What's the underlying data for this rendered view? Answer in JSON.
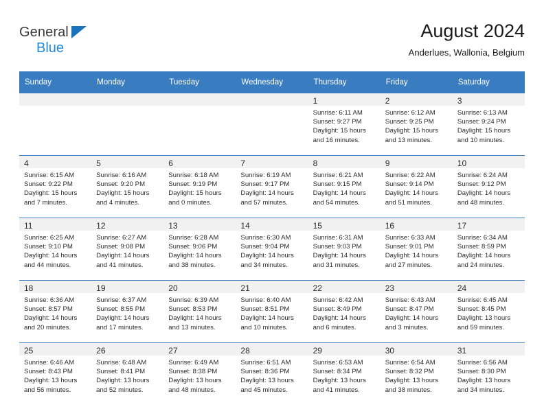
{
  "brand": {
    "name_top": "General",
    "name_bottom": "Blue",
    "triangle_color": "#1a72ba",
    "blue_color": "#2389d6"
  },
  "header": {
    "month_title": "August 2024",
    "location": "Anderlues, Wallonia, Belgium"
  },
  "calendar": {
    "header_bg": "#3a7cc0",
    "daynum_bg": "#f1f1f1",
    "weekdays": [
      "Sunday",
      "Monday",
      "Tuesday",
      "Wednesday",
      "Thursday",
      "Friday",
      "Saturday"
    ],
    "weeks": [
      [
        {
          "day": "",
          "lines": []
        },
        {
          "day": "",
          "lines": []
        },
        {
          "day": "",
          "lines": []
        },
        {
          "day": "",
          "lines": []
        },
        {
          "day": "1",
          "lines": [
            "Sunrise: 6:11 AM",
            "Sunset: 9:27 PM",
            "Daylight: 15 hours",
            "and 16 minutes."
          ]
        },
        {
          "day": "2",
          "lines": [
            "Sunrise: 6:12 AM",
            "Sunset: 9:25 PM",
            "Daylight: 15 hours",
            "and 13 minutes."
          ]
        },
        {
          "day": "3",
          "lines": [
            "Sunrise: 6:13 AM",
            "Sunset: 9:24 PM",
            "Daylight: 15 hours",
            "and 10 minutes."
          ]
        }
      ],
      [
        {
          "day": "4",
          "lines": [
            "Sunrise: 6:15 AM",
            "Sunset: 9:22 PM",
            "Daylight: 15 hours",
            "and 7 minutes."
          ]
        },
        {
          "day": "5",
          "lines": [
            "Sunrise: 6:16 AM",
            "Sunset: 9:20 PM",
            "Daylight: 15 hours",
            "and 4 minutes."
          ]
        },
        {
          "day": "6",
          "lines": [
            "Sunrise: 6:18 AM",
            "Sunset: 9:19 PM",
            "Daylight: 15 hours",
            "and 0 minutes."
          ]
        },
        {
          "day": "7",
          "lines": [
            "Sunrise: 6:19 AM",
            "Sunset: 9:17 PM",
            "Daylight: 14 hours",
            "and 57 minutes."
          ]
        },
        {
          "day": "8",
          "lines": [
            "Sunrise: 6:21 AM",
            "Sunset: 9:15 PM",
            "Daylight: 14 hours",
            "and 54 minutes."
          ]
        },
        {
          "day": "9",
          "lines": [
            "Sunrise: 6:22 AM",
            "Sunset: 9:14 PM",
            "Daylight: 14 hours",
            "and 51 minutes."
          ]
        },
        {
          "day": "10",
          "lines": [
            "Sunrise: 6:24 AM",
            "Sunset: 9:12 PM",
            "Daylight: 14 hours",
            "and 48 minutes."
          ]
        }
      ],
      [
        {
          "day": "11",
          "lines": [
            "Sunrise: 6:25 AM",
            "Sunset: 9:10 PM",
            "Daylight: 14 hours",
            "and 44 minutes."
          ]
        },
        {
          "day": "12",
          "lines": [
            "Sunrise: 6:27 AM",
            "Sunset: 9:08 PM",
            "Daylight: 14 hours",
            "and 41 minutes."
          ]
        },
        {
          "day": "13",
          "lines": [
            "Sunrise: 6:28 AM",
            "Sunset: 9:06 PM",
            "Daylight: 14 hours",
            "and 38 minutes."
          ]
        },
        {
          "day": "14",
          "lines": [
            "Sunrise: 6:30 AM",
            "Sunset: 9:04 PM",
            "Daylight: 14 hours",
            "and 34 minutes."
          ]
        },
        {
          "day": "15",
          "lines": [
            "Sunrise: 6:31 AM",
            "Sunset: 9:03 PM",
            "Daylight: 14 hours",
            "and 31 minutes."
          ]
        },
        {
          "day": "16",
          "lines": [
            "Sunrise: 6:33 AM",
            "Sunset: 9:01 PM",
            "Daylight: 14 hours",
            "and 27 minutes."
          ]
        },
        {
          "day": "17",
          "lines": [
            "Sunrise: 6:34 AM",
            "Sunset: 8:59 PM",
            "Daylight: 14 hours",
            "and 24 minutes."
          ]
        }
      ],
      [
        {
          "day": "18",
          "lines": [
            "Sunrise: 6:36 AM",
            "Sunset: 8:57 PM",
            "Daylight: 14 hours",
            "and 20 minutes."
          ]
        },
        {
          "day": "19",
          "lines": [
            "Sunrise: 6:37 AM",
            "Sunset: 8:55 PM",
            "Daylight: 14 hours",
            "and 17 minutes."
          ]
        },
        {
          "day": "20",
          "lines": [
            "Sunrise: 6:39 AM",
            "Sunset: 8:53 PM",
            "Daylight: 14 hours",
            "and 13 minutes."
          ]
        },
        {
          "day": "21",
          "lines": [
            "Sunrise: 6:40 AM",
            "Sunset: 8:51 PM",
            "Daylight: 14 hours",
            "and 10 minutes."
          ]
        },
        {
          "day": "22",
          "lines": [
            "Sunrise: 6:42 AM",
            "Sunset: 8:49 PM",
            "Daylight: 14 hours",
            "and 6 minutes."
          ]
        },
        {
          "day": "23",
          "lines": [
            "Sunrise: 6:43 AM",
            "Sunset: 8:47 PM",
            "Daylight: 14 hours",
            "and 3 minutes."
          ]
        },
        {
          "day": "24",
          "lines": [
            "Sunrise: 6:45 AM",
            "Sunset: 8:45 PM",
            "Daylight: 13 hours",
            "and 59 minutes."
          ]
        }
      ],
      [
        {
          "day": "25",
          "lines": [
            "Sunrise: 6:46 AM",
            "Sunset: 8:43 PM",
            "Daylight: 13 hours",
            "and 56 minutes."
          ]
        },
        {
          "day": "26",
          "lines": [
            "Sunrise: 6:48 AM",
            "Sunset: 8:41 PM",
            "Daylight: 13 hours",
            "and 52 minutes."
          ]
        },
        {
          "day": "27",
          "lines": [
            "Sunrise: 6:49 AM",
            "Sunset: 8:38 PM",
            "Daylight: 13 hours",
            "and 48 minutes."
          ]
        },
        {
          "day": "28",
          "lines": [
            "Sunrise: 6:51 AM",
            "Sunset: 8:36 PM",
            "Daylight: 13 hours",
            "and 45 minutes."
          ]
        },
        {
          "day": "29",
          "lines": [
            "Sunrise: 6:53 AM",
            "Sunset: 8:34 PM",
            "Daylight: 13 hours",
            "and 41 minutes."
          ]
        },
        {
          "day": "30",
          "lines": [
            "Sunrise: 6:54 AM",
            "Sunset: 8:32 PM",
            "Daylight: 13 hours",
            "and 38 minutes."
          ]
        },
        {
          "day": "31",
          "lines": [
            "Sunrise: 6:56 AM",
            "Sunset: 8:30 PM",
            "Daylight: 13 hours",
            "and 34 minutes."
          ]
        }
      ]
    ]
  }
}
